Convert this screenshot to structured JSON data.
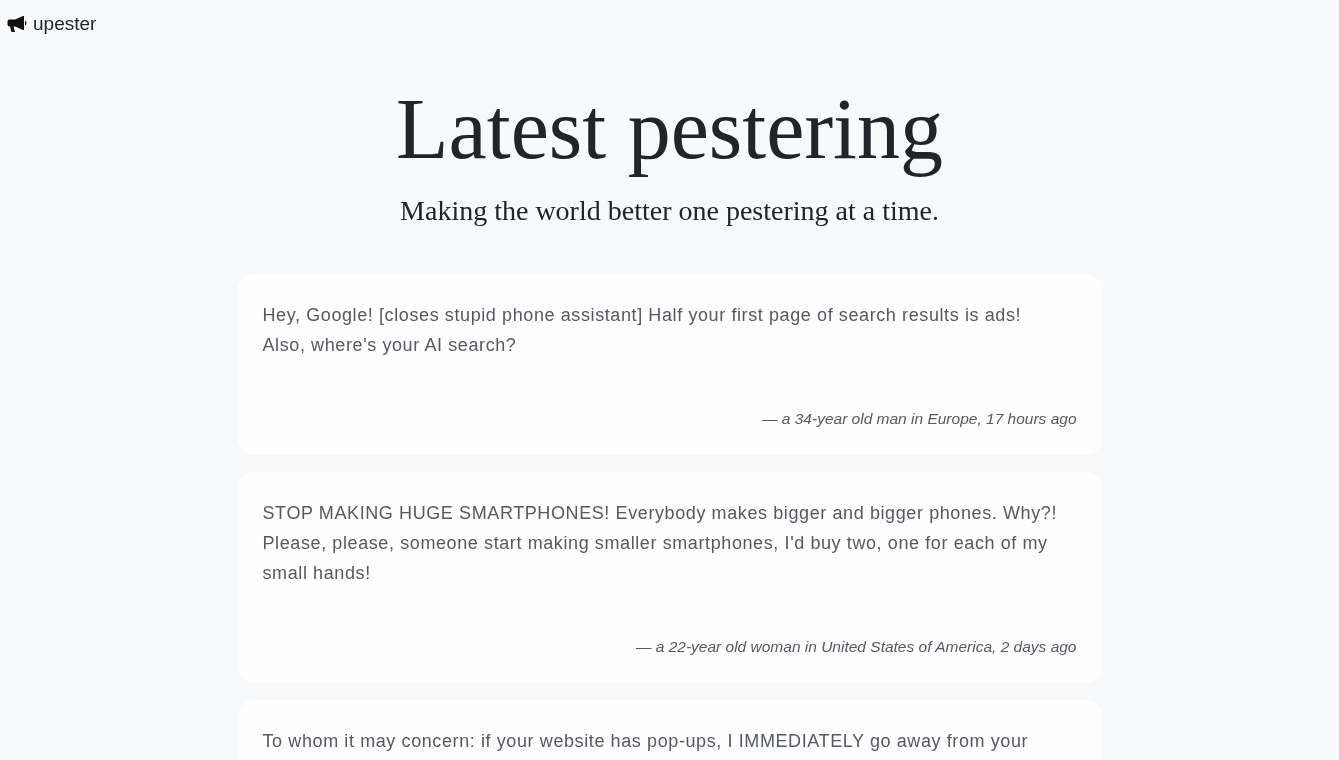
{
  "header": {
    "brand": "upester"
  },
  "hero": {
    "title": "Latest pestering",
    "subtitle": "Making the world better one pestering at a time."
  },
  "posts": [
    {
      "text": "Hey, Google! [closes stupid phone assistant] Half your first page of search results is ads! Also, where's your AI search?",
      "attribution": "— a 34-year old man in Europe, 17 hours ago"
    },
    {
      "text": "STOP MAKING HUGE SMARTPHONES! Everybody makes bigger and bigger phones. Why?! Please, please, someone start making smaller smartphones, I'd buy two, one for each of my small hands!",
      "attribution": "— a 22-year old woman in United States of America, 2 days ago"
    },
    {
      "text": "To whom it may concern: if your website has pop-ups, I IMMEDIATELY go away from your"
    }
  ]
}
